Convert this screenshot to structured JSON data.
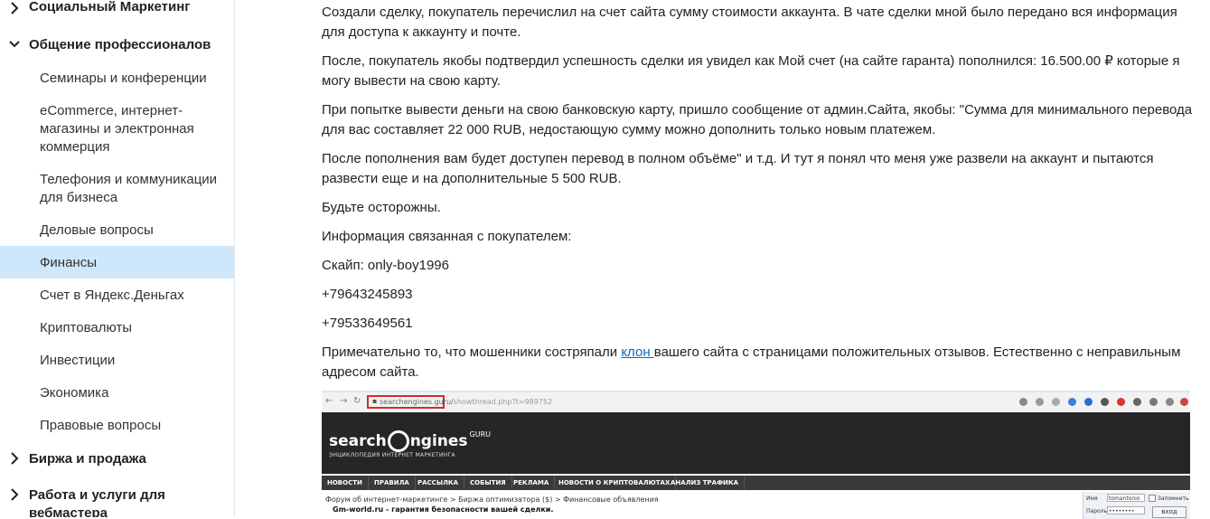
{
  "sidebar": {
    "categories": [
      {
        "label": "Социальный Маркетинг",
        "expanded": false
      },
      {
        "label": "Общение профессионалов",
        "expanded": true
      },
      {
        "label": "Биржа и продажа",
        "expanded": false
      },
      {
        "label": "Работа и услуги для вебмастера",
        "expanded": false
      }
    ],
    "subitems": [
      {
        "label": "Семинары и конференции",
        "active": false
      },
      {
        "label": "eCommerce, интернет-магазины и электронная коммерция",
        "active": false
      },
      {
        "label": "Телефония и коммуникации для бизнеса",
        "active": false
      },
      {
        "label": "Деловые вопросы",
        "active": false
      },
      {
        "label": "Финансы",
        "active": true
      },
      {
        "label": "Счет в Яндекс.Деньгах",
        "active": false
      },
      {
        "label": "Криптовалюты",
        "active": false
      },
      {
        "label": "Инвестиции",
        "active": false
      },
      {
        "label": "Экономика",
        "active": false
      },
      {
        "label": "Правовые вопросы",
        "active": false
      }
    ],
    "chevron_right_icon": "chevron-right-icon",
    "chevron_down_icon": "chevron-down-icon",
    "active_color": "#cfe7fb"
  },
  "post": {
    "p1": "Создали сделку, покупатель перечислил на счет сайта сумму стоимости аккаунта. В чате сделки мной было передано вся информация для доступа к аккаунту и почте.",
    "p2": "После, покупатель якобы подтвердил успешность сделки ия увидел как Мой счет (на сайте гаранта) пополнился: 16.500.00 ₽ которые я могу вывести на свою карту.",
    "p3": "При попытке вывести деньги на свою банковскую карту, пришло сообщение от админ.Сайта, якобы: \"Сумма для минимального перевода для вас составляет 22 000 RUB, недостающую сумму можно дополнить только новым платежем.",
    "p4": "После пополнения вам будет доступен перевод в полном объёме\" и т.д. И тут я понял что меня уже развели на аккаунт и пытаются развести еще и на дополнительные 5 500 RUB.",
    "p5": "Будьте осторожны.",
    "p6": "Информация связанная с покупателем:",
    "p7": "Скайп: only-boy1996",
    "p8": "+79643245893",
    "p9": "+79533649561",
    "p10_before": "Примечательно то, что мошенники состряпали ",
    "p10_link": "клон ",
    "p10_after": "вашего сайта с страницами положительных отзывов. Естественно с неправильным адресом сайта.",
    "link_color": "#0a69c4"
  },
  "screenshot": {
    "url_highlight": "searchengines.guru/",
    "url_rest": "showthread.php?t=989752",
    "logo_left": "search",
    "logo_right": "ngines",
    "logo_suffix": "GURU",
    "logo_sub": "ЭНЦИКЛОПЕДИЯ ИНТЕРНЕТ МАРКЕТИНГА",
    "menu": [
      "НОВОСТИ",
      "ПРАВИЛА",
      "РАССЫЛКА",
      "СОБЫТИЯ",
      "РЕКЛАМА",
      "НОВОСТИ О КРИПТОВАЛЮТАХ",
      "АНАЛИЗ ТРАФИКА"
    ],
    "crumbs": "Форум об интернет-маркетинге > Биржа оптимизатора ($) > Финансовые объявления",
    "thread": "Gm-world.ru - гарантия безопасности вашей сделки.",
    "login_name_label": "Имя",
    "login_name_value": "tomantonio",
    "login_remember": "Запомнить",
    "login_pass_label": "Пароль",
    "login_pass_value": "••••••••",
    "login_button": "вход",
    "highlight_color": "#d12a2a"
  }
}
